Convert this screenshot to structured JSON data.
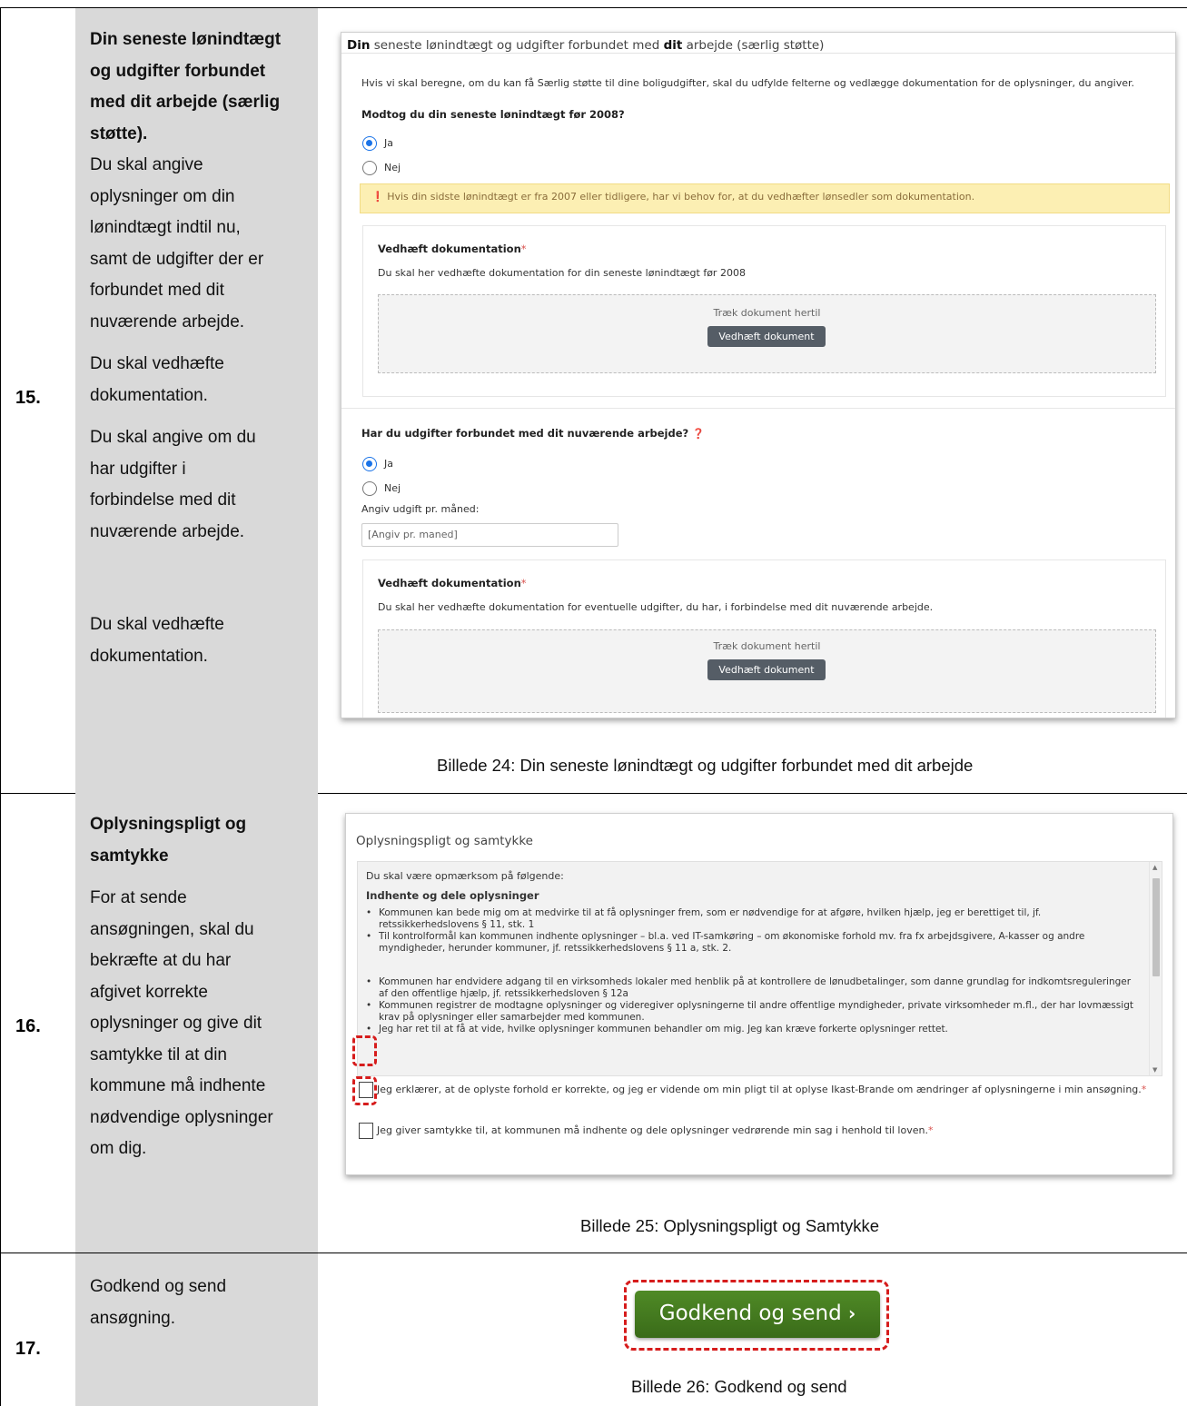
{
  "rows": {
    "r15": {
      "number": "15.",
      "title_lines": [
        "Din seneste lønindtægt",
        "og udgifter forbundet",
        "med dit arbejde (særlig",
        "støtte)."
      ],
      "para1_lines": [
        "Du skal angive",
        "oplysninger om din",
        "lønindtægt indtil nu,",
        "samt de udgifter der er",
        "forbundet med dit",
        "nuværende arbejde."
      ],
      "para2_lines": [
        "Du skal vedhæfte",
        "dokumentation."
      ],
      "para3_lines": [
        "Du skal angive om du",
        "har udgifter i",
        "forbindelse med dit",
        "nuværende arbejde."
      ],
      "para4_lines": [
        "Du skal vedhæfte",
        "dokumentation."
      ],
      "caption": "Billede 24: Din seneste lønindtægt og udgifter forbundet med dit arbejde"
    },
    "r16": {
      "number": "16.",
      "title_lines": [
        "Oplysningspligt og",
        "samtykke"
      ],
      "para_lines": [
        "For at sende",
        "ansøgningen, skal du",
        "bekræfte at du har",
        "afgivet korrekte",
        "oplysninger og give dit",
        "samtykke til at din",
        "kommune må indhente",
        "nødvendige oplysninger",
        "om dig."
      ],
      "caption": "Billede 25: Oplysningspligt og Samtykke"
    },
    "r17": {
      "number": "17.",
      "text_lines": [
        "Godkend og send",
        "ansøgning."
      ],
      "caption": "Billede 26: Godkend og send"
    }
  },
  "shot15": {
    "header_pre1": "Din",
    "header_mid": " seneste lønindtægt og udgifter forbundet med ",
    "header_bold2": "dit",
    "header_post": " arbejde (særlig støtte)",
    "intro": "Hvis vi skal beregne, om du kan få Særlig støtte til dine boligudgifter, skal du udfylde felterne og vedlægge dokumentation for de oplysninger, du angiver.",
    "q1": "Modtog du din seneste lønindtægt før 2008?",
    "yes": "Ja",
    "no": "Nej",
    "warning_icon": "exclamation-circle-icon",
    "warning": "Hvis din sidste lønindtægt er fra 2007 eller tidligere, har vi behov for, at du vedhæfter lønsedler som dokumentation.",
    "attach_title": "Vedhæft dokumentation",
    "attach_star": "*",
    "attach_desc1": "Du skal her vedhæfte dokumentation for din seneste lønindtægt før 2008",
    "drop_text": "Træk dokument hertil",
    "attach_button": "Vedhæft dokument",
    "q2": "Har du udgifter forbundet med dit nuværende arbejde?",
    "q2_icon": "question-circle-icon",
    "amount_label": "Angiv udgift pr. måned:",
    "amount_placeholder": "[Angiv pr. maned]",
    "attach_desc2": "Du skal her vedhæfte dokumentation for eventuelle udgifter, du har, i forbindelse med dit nuværende arbejde."
  },
  "shot16": {
    "header": "Oplysningspligt og samtykke",
    "intro": "Du skal være opmærksom på følgende:",
    "section": "Indhente og dele oplysninger",
    "bullets": [
      "Kommunen kan bede mig om at medvirke til at få oplysninger frem, som er nødvendige for at afgøre, hvilken hjælp, jeg er berettiget til, jf. retssikkerhedslovens § 11, stk. 1",
      "Til kontrolformål kan kommunen indhente oplysninger – bl.a. ved IT-samkøring – om økonomiske forhold mv. fra fx arbejdsgivere, A-kasser og andre myndigheder, herunder kommuner, jf. retssikkerhedslovens § 11 a, stk. 2."
    ],
    "bullets2": [
      "Kommunen har endvidere adgang til en virksomheds lokaler med henblik på at kontrollere de lønudbetalinger, som danne grundlag for indkomtsreguleringer af den offentlige hjælp, jf. retssikkerhedsloven § 12a",
      "Kommunen registrer de modtagne oplysninger og videregiver oplysningerne til andre offentlige myndigheder, private virksomheder m.fl., der har lovmæssigt krav på oplysninger eller samarbejder med kommunen.",
      "Jeg har ret til at få at vide, hvilke oplysninger kommunen behandler om mig. Jeg kan kræve forkerte oplysninger rettet."
    ],
    "check1": "Jeg erklærer, at de oplyste forhold er korrekte, og jeg er vidende om min pligt til at oplyse Ikast-Brande om ændringer af oplysningerne i min ansøgning.",
    "check2": "Jeg giver samtykke til, at kommunen må indhente og dele oplysninger vedrørende min sag i henhold til loven.",
    "star": "*"
  },
  "shot17": {
    "button": "Godkend og send",
    "button_icon": "chevron-right-icon"
  },
  "colors": {
    "grey_column": "#d9d9d9",
    "radio_accent": "#1a73e8",
    "warning_bg": "#fcefb3",
    "highlight_red": "#d61c1c",
    "button_green": "#457a20"
  }
}
